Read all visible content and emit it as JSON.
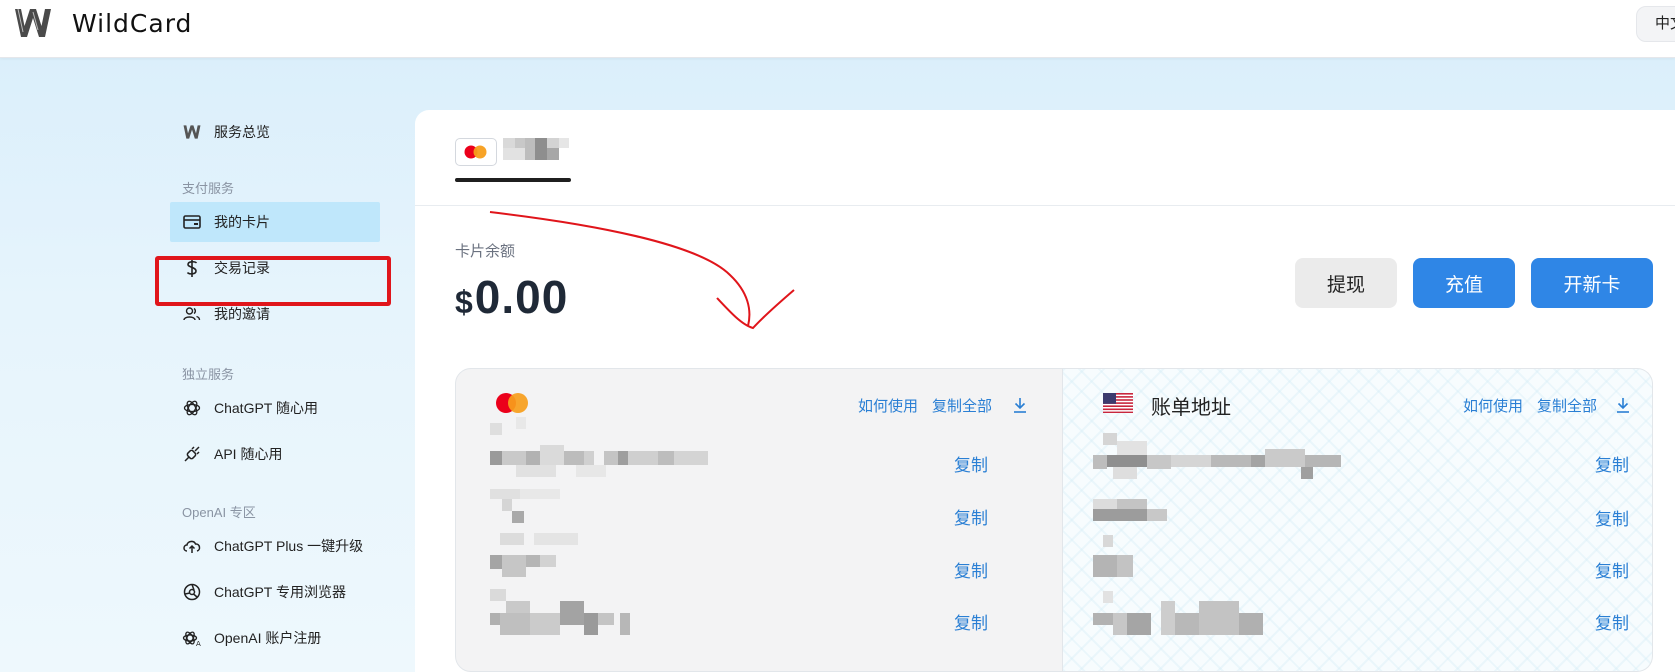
{
  "header": {
    "brand": "WildCard",
    "language_button": "中文"
  },
  "sidebar": {
    "overview": "服务总览",
    "section_payment": "支付服务",
    "my_cards": "我的卡片",
    "transactions": "交易记录",
    "invites": "我的邀请",
    "section_independent": "独立服务",
    "chatgpt_anytime": "ChatGPT 随心用",
    "api_anytime": "API 随心用",
    "section_openai": "OpenAI 专区",
    "chatgpt_plus": "ChatGPT Plus 一键升级",
    "chatgpt_browser": "ChatGPT 专用浏览器",
    "openai_register": "OpenAI 账户注册"
  },
  "main": {
    "balance_label": "卡片余额",
    "currency_symbol": "$",
    "balance_amount": "0.00",
    "withdraw_button": "提现",
    "recharge_button": "充值",
    "new_card_button": "开新卡"
  },
  "card_details": {
    "how_to_use": "如何使用",
    "copy_all": "复制全部",
    "copy": "复制"
  },
  "billing": {
    "title": "账单地址",
    "how_to_use": "如何使用",
    "copy_all": "复制全部",
    "copy": "复制"
  },
  "colors": {
    "accent_blue": "#2f86e6",
    "link_blue": "#2a7fd4",
    "active_item_bg": "#bfe7fb",
    "annotation_red": "#e0151b"
  }
}
